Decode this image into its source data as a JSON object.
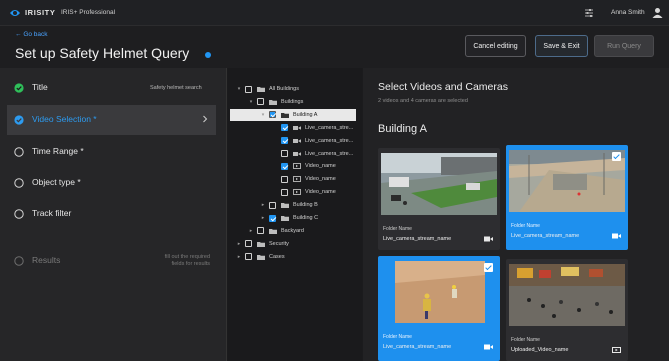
{
  "app": {
    "brand": "IRISITY",
    "product": "IRIS+ Professional",
    "user_name": "Anna Smith"
  },
  "header": {
    "back_label": "Go back",
    "title": "Set up Safety Helmet Query",
    "cancel_label": "Cancel editing",
    "save_label": "Save & Exit",
    "run_label": "Run Query"
  },
  "steps": [
    {
      "label": "Title",
      "value": "Safety helmet search",
      "state": "done"
    },
    {
      "label": "Video Selection *",
      "value": "",
      "state": "active"
    },
    {
      "label": "Time Range *",
      "value": "",
      "state": "todo"
    },
    {
      "label": "Object type *",
      "value": "",
      "state": "todo"
    },
    {
      "label": "Track filter",
      "value": "",
      "state": "todo"
    },
    {
      "label": "Results",
      "value": "",
      "state": "disabled",
      "note_line1": "fill out the required",
      "note_line2": "fields for results"
    }
  ],
  "tree": [
    {
      "label": "All Buildings",
      "level": 0,
      "checked": false,
      "icon": "folder-icon"
    },
    {
      "label": "Buildings",
      "level": 1,
      "checked": false,
      "icon": "folder-icon"
    },
    {
      "label": "Building A",
      "level": 2,
      "checked": true,
      "icon": "folder-icon",
      "selected": true
    },
    {
      "label": "Live_camera_stre...",
      "level": 3,
      "checked": true,
      "icon": "camera-icon"
    },
    {
      "label": "Live_camera_stre...",
      "level": 3,
      "checked": true,
      "icon": "camera-icon"
    },
    {
      "label": "Live_camera_stre...",
      "level": 3,
      "checked": false,
      "icon": "camera-icon"
    },
    {
      "label": "Video_name",
      "level": 3,
      "checked": true,
      "icon": "video-icon"
    },
    {
      "label": "Video_name",
      "level": 3,
      "checked": false,
      "icon": "video-icon"
    },
    {
      "label": "Video_name",
      "level": 3,
      "checked": false,
      "icon": "video-icon"
    },
    {
      "label": "Building B",
      "level": 2,
      "checked": false,
      "icon": "folder-icon"
    },
    {
      "label": "Building C",
      "level": 2,
      "checked": true,
      "icon": "folder-icon"
    },
    {
      "label": "Backyard",
      "level": 1,
      "checked": false,
      "icon": "folder-icon"
    },
    {
      "label": "Security",
      "level": 0,
      "checked": false,
      "icon": "folder-icon"
    },
    {
      "label": "Cases",
      "level": 0,
      "checked": false,
      "icon": "folder-icon"
    }
  ],
  "main": {
    "title": "Select Videos and Cameras",
    "subtitle": "2 videos and 4 cameras are selected",
    "group": "Building A"
  },
  "cards": [
    {
      "folder": "Folder Name",
      "name": "Live_camera_stream_name",
      "selected": false,
      "type_icon": "camera-icon"
    },
    {
      "folder": "Folder Name",
      "name": "Live_camera_stream_name",
      "selected": true,
      "type_icon": "camera-icon"
    },
    {
      "folder": "Folder Name",
      "name": "Live_camera_stream_name",
      "selected": true,
      "type_icon": "camera-icon"
    },
    {
      "folder": "Folder Name",
      "name": "Uploaded_Video_name",
      "selected": false,
      "type_icon": "video-icon"
    }
  ],
  "colors": {
    "accent": "#2196f3",
    "selected_card": "#1e90ee",
    "done": "#2fbf5a",
    "background": "#1b1b1d"
  }
}
